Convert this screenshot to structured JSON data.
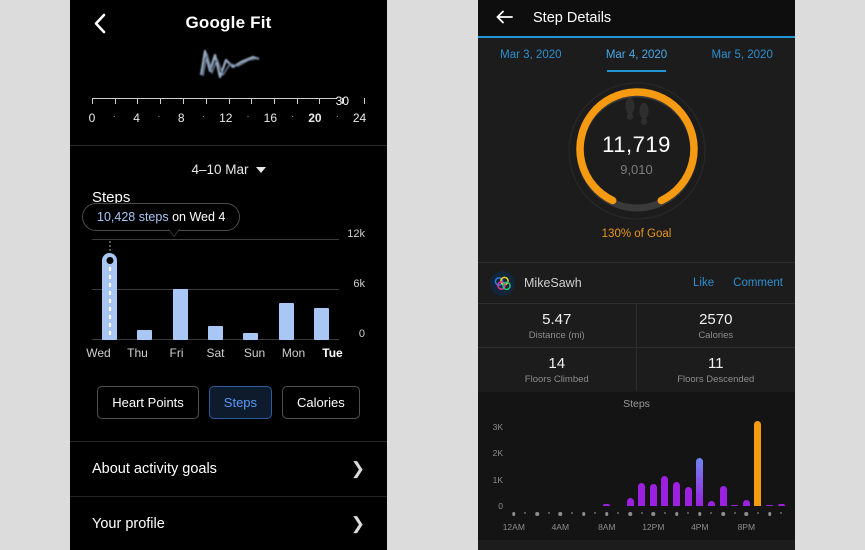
{
  "page": {
    "background": "#dcdcdc"
  },
  "left": {
    "header": {
      "back_icon": "chevron-left-icon",
      "title": "Google Fit"
    },
    "wave_icon": "waveform-graphic",
    "ruler": {
      "end_label": "30",
      "labels": [
        "0",
        "·",
        "4",
        "·",
        "8",
        "·",
        "12",
        "·",
        "16",
        "·",
        "20",
        "·",
        "24"
      ],
      "bold_index": 10
    },
    "range": {
      "label": "4–10 Mar",
      "caret_icon": "caret-down-icon"
    },
    "metric_label": "Steps",
    "tooltip": {
      "value": "10,428 steps",
      "suffix": " on Wed 4"
    },
    "chips": [
      {
        "label": "Heart Points",
        "active": false
      },
      {
        "label": "Steps",
        "active": true
      },
      {
        "label": "Calories",
        "active": false
      }
    ],
    "rows": [
      {
        "label": "About activity goals",
        "chevron": "chevron-right-icon"
      },
      {
        "label": "Your profile",
        "chevron": "chevron-right-icon"
      }
    ],
    "accent": "#a8c7f5",
    "chip_active_color": "#5b9bf8"
  },
  "right": {
    "header": {
      "back_icon": "arrow-left-icon",
      "title": "Step Details"
    },
    "dates": [
      {
        "label": "Mar 3, 2020",
        "active": false
      },
      {
        "label": "Mar 4, 2020",
        "active": true
      },
      {
        "label": "Mar 5, 2020",
        "active": false
      }
    ],
    "ring": {
      "steps": "11,719",
      "goal": "9,010",
      "goal_text": "130% of Goal",
      "percent": 130,
      "color": "#f59a11",
      "track_color": "#3a3a3a",
      "foot_icon": "footprints-icon"
    },
    "user": {
      "avatar_icon": "rings-avatar-icon",
      "name": "MikeSawh",
      "like_label": "Like",
      "comment_label": "Comment"
    },
    "stats": [
      {
        "value": "5.47",
        "label": "Distance (mi)"
      },
      {
        "value": "2570",
        "label": "Calories"
      },
      {
        "value": "14",
        "label": "Floors Climbed"
      },
      {
        "value": "11",
        "label": "Floors Descended"
      }
    ]
  },
  "chart_data": [
    {
      "type": "bar",
      "id": "weekly-steps",
      "title": "Steps",
      "subtitle": "4–10 Mar",
      "categories": [
        "Wed",
        "Thu",
        "Fri",
        "Sat",
        "Sun",
        "Mon",
        "Tue"
      ],
      "values": [
        10428,
        1200,
        6100,
        1700,
        900,
        4400,
        3900
      ],
      "selected_index": 0,
      "selected_label": "10,428 steps on Wed 4",
      "ylabel": "",
      "xlabel": "",
      "ylim": [
        0,
        12000
      ],
      "yticks": [
        0,
        6000,
        12000
      ],
      "ytick_labels": [
        "0",
        "6k",
        "12k"
      ],
      "grid": true,
      "bar_color": "#a8c7f5",
      "legend": "none"
    },
    {
      "type": "bar",
      "id": "hourly-steps",
      "title": "Steps",
      "x": [
        "12AM",
        "1AM",
        "2AM",
        "3AM",
        "4AM",
        "5AM",
        "6AM",
        "7AM",
        "8AM",
        "9AM",
        "10AM",
        "11AM",
        "12PM",
        "1PM",
        "2PM",
        "3PM",
        "4PM",
        "5PM",
        "6PM",
        "7PM",
        "8PM",
        "9PM",
        "10PM",
        "11PM"
      ],
      "values": [
        0,
        0,
        0,
        0,
        0,
        0,
        0,
        0,
        90,
        0,
        310,
        880,
        820,
        1150,
        900,
        730,
        1800,
        190,
        740,
        20,
        220,
        3200,
        30,
        60
      ],
      "ylabel": "",
      "xlabel": "",
      "ylim": [
        0,
        3400
      ],
      "yticks": [
        0,
        1000,
        2000,
        3000
      ],
      "ytick_labels": [
        "0",
        "1K",
        "2K",
        "3K"
      ],
      "xtick_labels": [
        "12AM",
        "4AM",
        "8AM",
        "12PM",
        "4PM",
        "8PM"
      ],
      "xtick_positions": [
        0,
        4,
        8,
        12,
        16,
        20
      ],
      "grid": false,
      "bar_color_low": "#9b20e0",
      "bar_color_high": "#6f86f0",
      "highlight_color": "#f59a11",
      "highlight_index": 21,
      "legend": "none"
    }
  ]
}
